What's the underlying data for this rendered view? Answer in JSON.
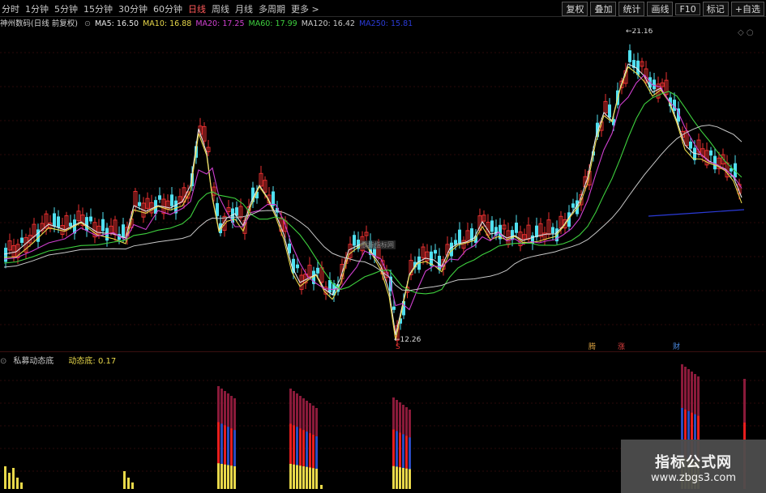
{
  "toolbar": {
    "periods": [
      "分时",
      "1分钟",
      "5分钟",
      "15分钟",
      "30分钟",
      "60分钟",
      "日线",
      "周线",
      "月线",
      "多周期",
      "更多 >"
    ],
    "active_period": "日线",
    "buttons": [
      "复权",
      "叠加",
      "统计",
      "画线",
      "F10",
      "标记",
      "+自选"
    ]
  },
  "info_bar": {
    "stock": "神州数码(日线 前复权)",
    "ma": [
      {
        "label": "MA5: 16.50",
        "color": "#e6e6e6"
      },
      {
        "label": "MA10: 16.88",
        "color": "#e8d84a"
      },
      {
        "label": "MA20: 17.25",
        "color": "#d040d0"
      },
      {
        "label": "MA60: 17.99",
        "color": "#3ed03e"
      },
      {
        "label": "MA120: 16.42",
        "color": "#c8c8c8"
      },
      {
        "label": "MA250: 15.81",
        "color": "#2b3bd8"
      }
    ]
  },
  "main_chart": {
    "high_label": "21.16",
    "low_label": "12.26",
    "markers": [
      {
        "text": "S",
        "color": "#e03030"
      },
      {
        "text": "腾",
        "color": "#d8a040"
      },
      {
        "text": "涨",
        "color": "#e04040"
      },
      {
        "text": "财",
        "color": "#4a8ae0"
      }
    ],
    "center_watermark": "股标指标网"
  },
  "sub_chart": {
    "indicator": "私募动态底",
    "value": "动态底: 0.17"
  },
  "watermark": {
    "title": "指标公式网",
    "url": "www.zbgs3.com"
  },
  "colors": {
    "up": "#e83030",
    "down": "#50e0f0",
    "ma5": "#e6e6e6",
    "ma10": "#e8d84a",
    "ma20": "#d040d0",
    "ma60": "#3ed03e",
    "ma120": "#c8c8c8",
    "ma250": "#2b3bd8"
  }
}
